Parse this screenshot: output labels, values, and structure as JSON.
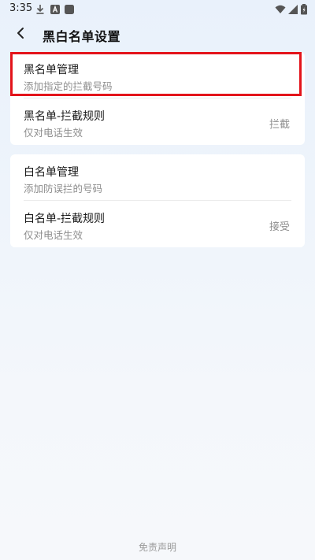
{
  "status_bar": {
    "time": "3:35",
    "left_icons": [
      "download-icon",
      "a-icon",
      "app-square-icon"
    ],
    "right_icons": [
      "wifi-icon",
      "signal-icon",
      "battery-icon"
    ]
  },
  "header": {
    "back_icon": "chevron-left-icon",
    "title": "黑白名单设置"
  },
  "blacklist_card": {
    "manage": {
      "title": "黑名单管理",
      "subtitle": "添加指定的拦截号码"
    },
    "rule": {
      "title": "黑名单-拦截规则",
      "subtitle": "仅对电话生效",
      "value": "拦截"
    }
  },
  "whitelist_card": {
    "manage": {
      "title": "白名单管理",
      "subtitle": "添加防误拦的号码"
    },
    "rule": {
      "title": "白名单-拦截规则",
      "subtitle": "仅对电话生效",
      "value": "接受"
    }
  },
  "footer": {
    "disclaimer": "免责声明"
  },
  "colors": {
    "highlight": "#e3141b",
    "subtitle_text": "#8e8e8e",
    "card_bg": "#ffffff"
  }
}
